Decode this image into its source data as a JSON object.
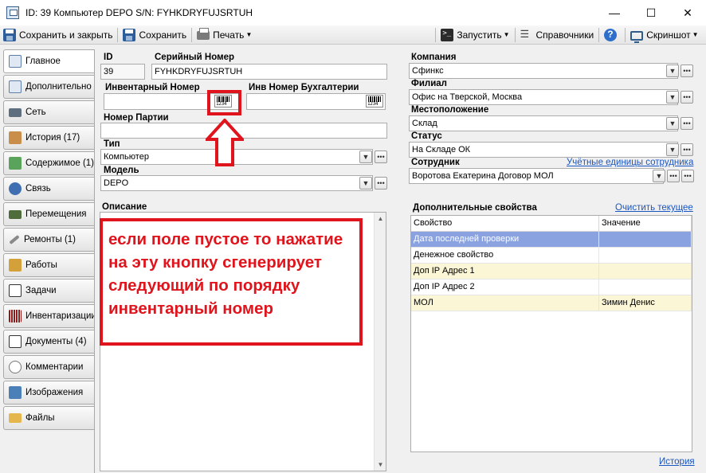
{
  "window": {
    "title": "ID: 39  Компьютер DEPO S/N: FYHKDRYFUJSRTUH",
    "minimize": "—",
    "maximize": "☐",
    "close": "✕"
  },
  "toolbar": {
    "save_close": "Сохранить и закрыть",
    "save": "Сохранить",
    "print": "Печать",
    "run": "Запустить",
    "references": "Справочники",
    "screenshot": "Скриншот"
  },
  "sidebar": {
    "items": [
      {
        "label": "Главное",
        "icon": "form-icon"
      },
      {
        "label": "Дополнительно",
        "icon": "form-icon"
      },
      {
        "label": "Сеть",
        "icon": "network-icon"
      },
      {
        "label": "История (17)",
        "icon": "history-icon"
      },
      {
        "label": "Содержимое (1)",
        "icon": "components-icon"
      },
      {
        "label": "Связь",
        "icon": "link-icon"
      },
      {
        "label": "Перемещения",
        "icon": "truck-icon"
      },
      {
        "label": "Ремонты (1)",
        "icon": "wrench-icon"
      },
      {
        "label": "Работы",
        "icon": "tools-icon"
      },
      {
        "label": "Задачи",
        "icon": "task-icon"
      },
      {
        "label": "Инвентаризации",
        "icon": "barcode-icon"
      },
      {
        "label": "Документы (4)",
        "icon": "document-icon"
      },
      {
        "label": "Комментарии",
        "icon": "comment-icon"
      },
      {
        "label": "Изображения",
        "icon": "image-icon"
      },
      {
        "label": "Файлы",
        "icon": "folder-icon"
      }
    ]
  },
  "form": {
    "id_label": "ID",
    "id_value": "39",
    "serial_label": "Серийный Номер",
    "serial_value": "FYHKDRYFUJSRTUH",
    "inventory_label": "Инвентарный Номер",
    "inventory_value": "",
    "accounting_label": "Инв Номер Бухгалтерии",
    "accounting_value": "",
    "barcode_digits": "1234",
    "batch_label": "Номер Партии",
    "batch_value": "",
    "type_label": "Тип",
    "type_value": "Компьютер",
    "model_label": "Модель",
    "model_value": "DEPO",
    "description_label": "Описание",
    "company_label": "Компания",
    "company_value": "Сфинкс",
    "branch_label": "Филиал",
    "branch_value": "Офис на Тверской, Москва",
    "location_label": "Местоположение",
    "location_value": "Склад",
    "status_label": "Статус",
    "status_value": "На Складе ОК",
    "employee_label": "Сотрудник",
    "employee_link": "Учётные единицы сотрудника",
    "employee_value": "Воротова Екатерина  Договор МОЛ"
  },
  "props": {
    "title": "Дополнительные свойства",
    "clear_link": "Очистить текущее",
    "col_property": "Свойство",
    "col_value": "Значение",
    "rows": [
      {
        "name": "Дата последней проверки",
        "value": "",
        "bg": "#8aa2e0"
      },
      {
        "name": "Денежное свойство",
        "value": "",
        "bg": "#ffffff"
      },
      {
        "name": "Доп IP Адрес 1",
        "value": "",
        "bg": "#fbf6d6"
      },
      {
        "name": "Доп IP Адрес 2",
        "value": "",
        "bg": "#ffffff"
      },
      {
        "name": "МОЛ",
        "value": "Зимин Денис",
        "bg": "#fbf6d6"
      }
    ],
    "history_link": "История"
  },
  "annotation": {
    "text": "если поле пустое то нажатие на эту кнопку сгенерирует следующий по порядку инвентарный номер",
    "color": "#e0141c"
  }
}
